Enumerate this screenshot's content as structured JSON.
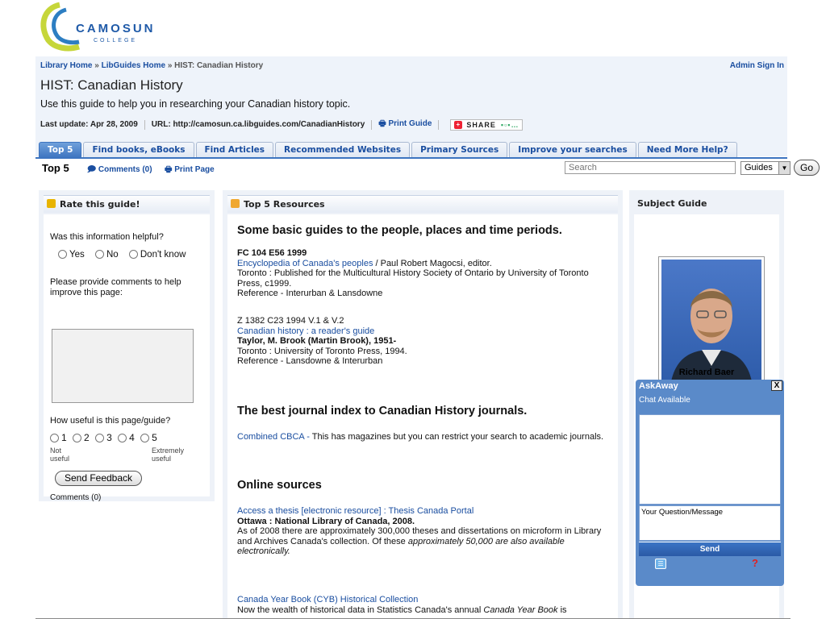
{
  "logo": {
    "name": "CAMOSUN",
    "sub": "COLLEGE"
  },
  "breadcrumb": {
    "items": [
      "Library Home",
      "LibGuides Home",
      "HIST: Canadian History"
    ],
    "sep": "»"
  },
  "admin_label": "Admin Sign In",
  "guide": {
    "title": "HIST: Canadian History",
    "description": "Use this guide to help you in researching your Canadian history topic.",
    "last_update": "Last update: Apr 28, 2009",
    "url_label": "URL: http://camosun.ca.libguides.com/CanadianHistory",
    "print_label": "Print Guide",
    "share_label": "SHARE"
  },
  "tabs": [
    "Top 5",
    "Find books, eBooks",
    "Find Articles",
    "Recommended Websites",
    "Primary Sources",
    "Improve your searches",
    "Need More Help?"
  ],
  "subbar": {
    "page": "Top 5",
    "comments": "Comments (0)",
    "print_page": "Print Page",
    "search_placeholder": "Search",
    "select_value": "Guides",
    "go": "Go"
  },
  "rate": {
    "title": "Rate this guide!",
    "helpful_q": "Was this information helpful?",
    "opt_yes": "Yes",
    "opt_no": "No",
    "opt_dontknow": "Don't know",
    "comments_prompt": "Please provide comments to help improve this page:",
    "useful_q": "How useful is this page/guide?",
    "scale": [
      "1",
      "2",
      "3",
      "4",
      "5"
    ],
    "low_label": "Not useful",
    "high_label": "Extremely useful",
    "send": "Send Feedback",
    "comments_link": "Comments (0)"
  },
  "resources": {
    "title": "Top 5 Resources",
    "h1": "Some basic guides to the people, places and time periods.",
    "r1_call": "FC 104 E56 1999",
    "r1_link": "Encyclopedia of Canada's peoples",
    "r1_author": " / Paul Robert Magocsi, editor.",
    "r1_pub": "Toronto : Published for the Multicultural History Society of Ontario by University of Toronto Press, c1999.",
    "r1_loc": "Reference - Interurban & Lansdowne",
    "r2_call": "Z 1382 C23 1994 V.1 & V.2",
    "r2_link": "Canadian history : a reader's guide",
    "r2_author": "Taylor, M. Brook (Martin Brook), 1951-",
    "r2_pub": "Toronto : University of Toronto Press, 1994.",
    "r2_loc": "Reference - Lansdowne & Interurban",
    "h2": "The best journal index to Canadian History journals.",
    "r3_link": "Combined CBCA - ",
    "r3_desc": "  This has magazines but you can restrict your search to academic journals.",
    "h3": "Online sources",
    "r4_link": "Access a thesis [electronic resource] : Thesis Canada Portal",
    "r4_pub": "Ottawa : National Library of Canada, 2008.",
    "r4_desc1": "As of 2008 there are approximately 300,000 theses and dissertations on microform in Library and Archives Canada's collection. Of these ",
    "r4_desc2": "approximately 50,000 are also available electronically.",
    "r5_link": "Canada Year Book (CYB) Historical Collection",
    "r5_desc1": "Now the wealth of historical data in Statistics Canada's annual ",
    "r5_desc2": "Canada Year Book",
    "r5_desc3": " is"
  },
  "subject": {
    "title": "Subject Guide",
    "name": "Richard Baer"
  },
  "askaway": {
    "title": "AskAway",
    "close": "X",
    "status": "Chat Available",
    "input_placeholder": "Your Question/Message",
    "send": "Send",
    "help": "?"
  },
  "colors": {
    "accent": "#3d74c0",
    "link": "#1a4ea0",
    "panel": "#eef2f8",
    "askaway": "#5a8ac9"
  }
}
